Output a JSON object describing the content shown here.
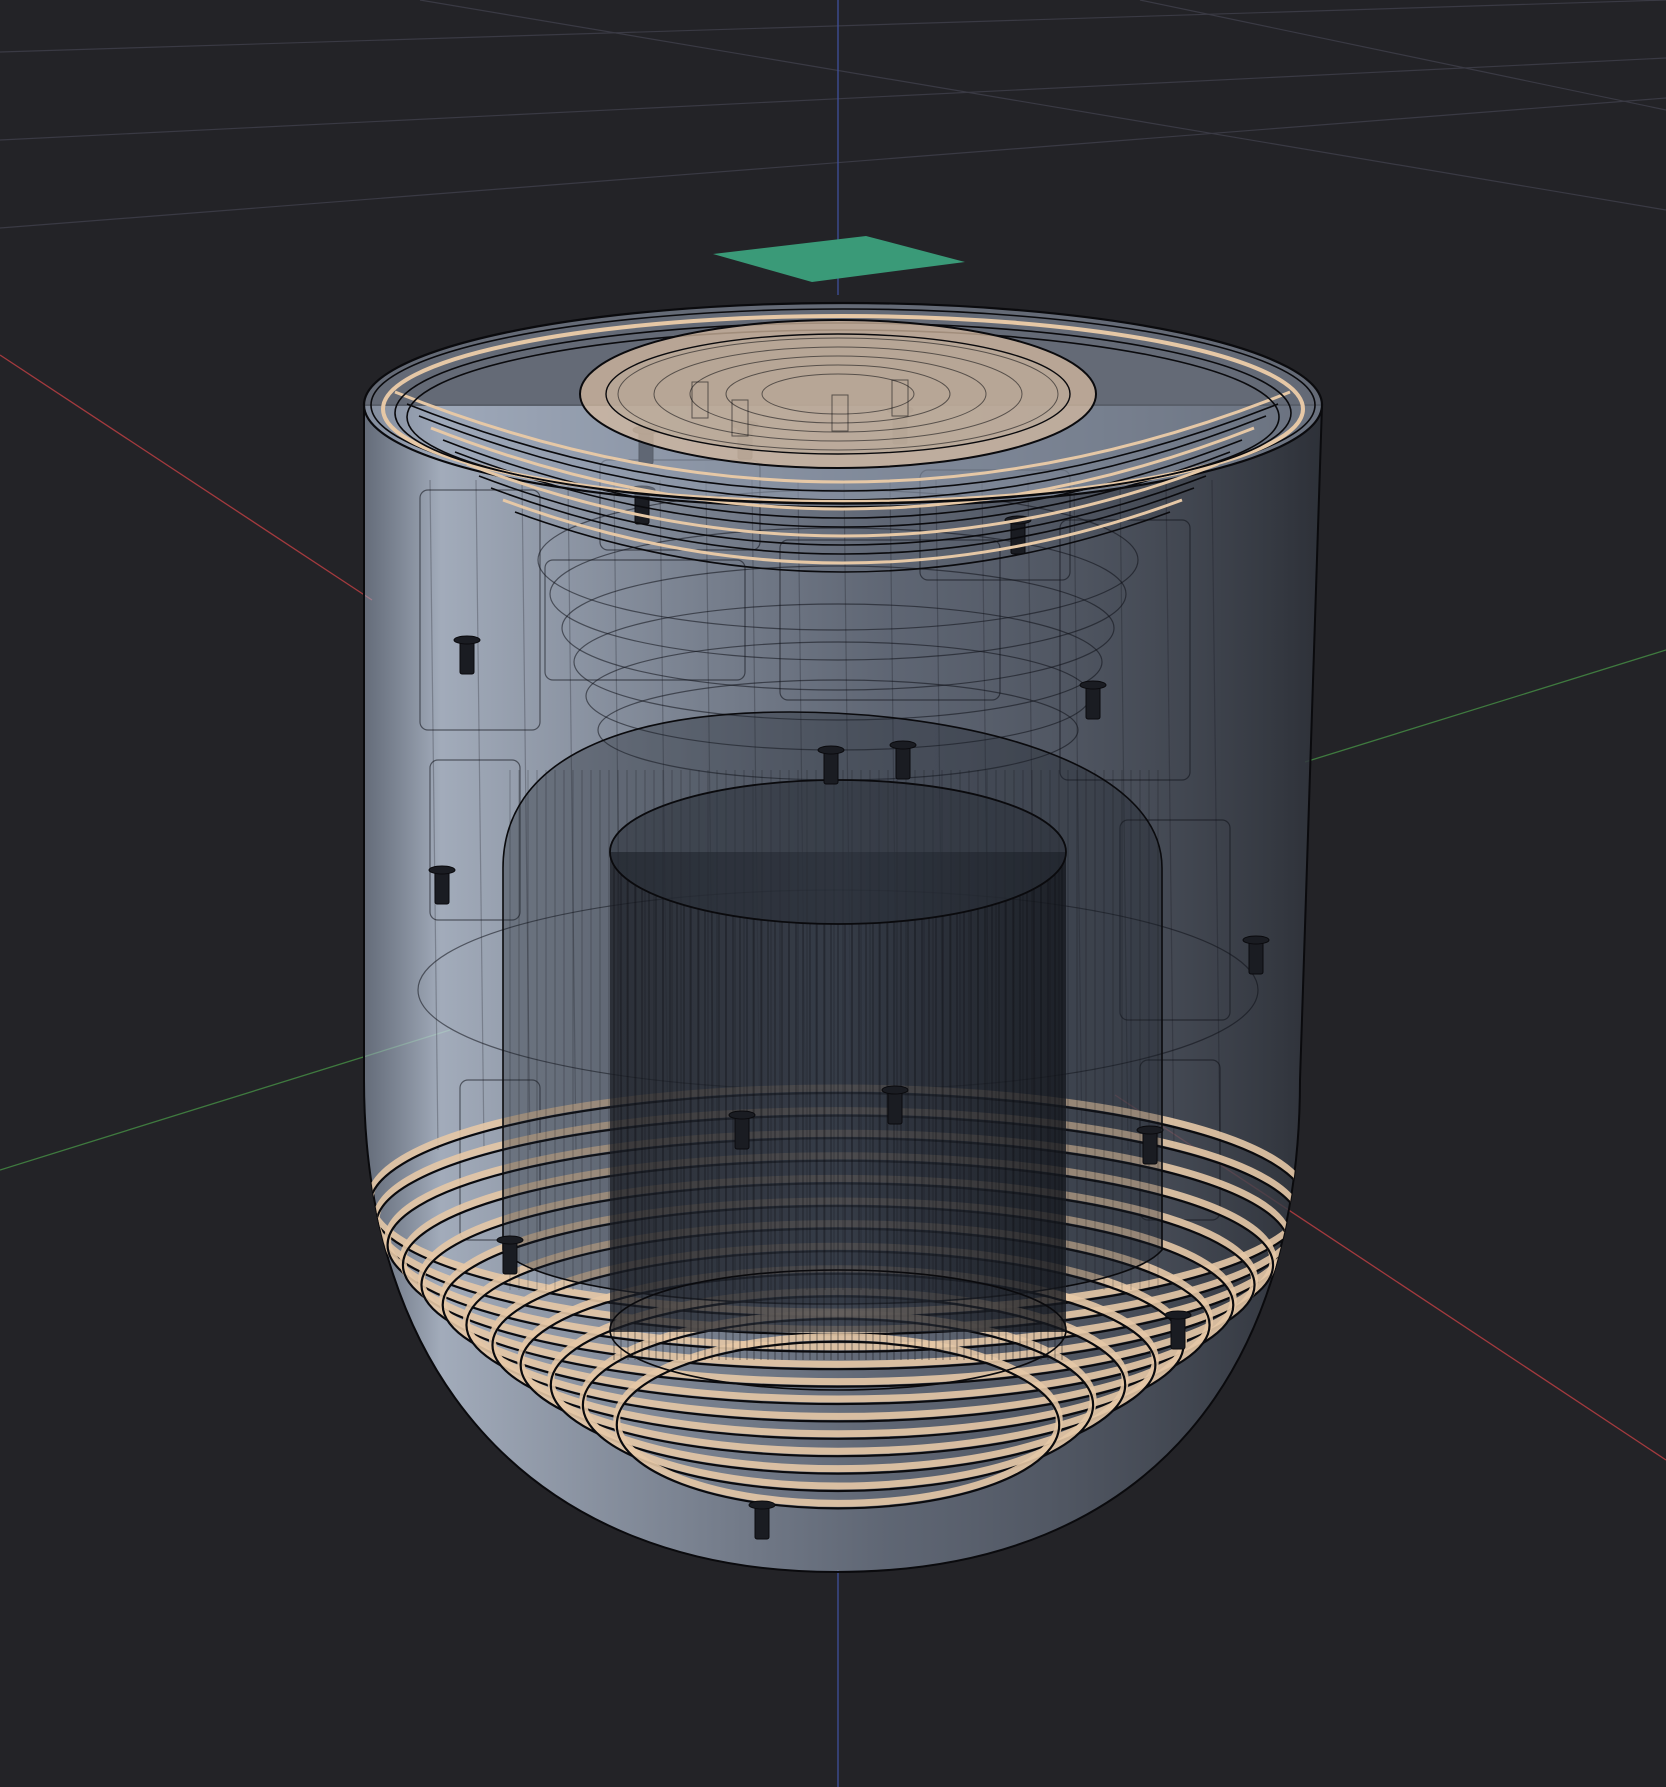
{
  "viewport": {
    "background_color": "#232327",
    "grid_color": "#3a3a44",
    "axes": {
      "x_color": "#a33a3e",
      "y_color": "#3f7a3f",
      "z_color": "#3f4f9a"
    },
    "light_marker_color": "#3a9a78",
    "model": {
      "shell_color": "#b4c4dc",
      "core_color": "#141820",
      "wood_color": "#e6c8a6",
      "line_color": "#0a0a0d"
    }
  }
}
